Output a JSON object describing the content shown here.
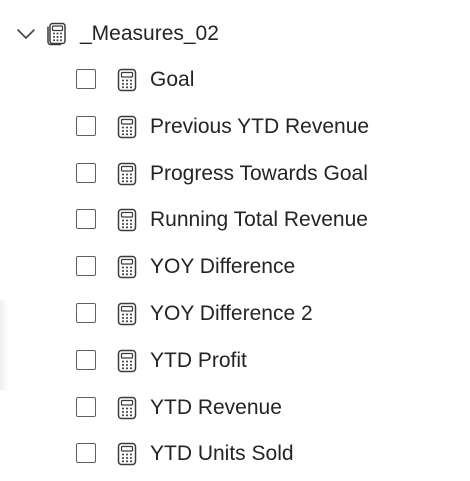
{
  "table": {
    "name": "_Measures_02",
    "expanded": true,
    "icon": "calculator-table-icon"
  },
  "fields": [
    {
      "label": "Goal",
      "checked": false,
      "icon": "calculator-icon"
    },
    {
      "label": "Previous YTD Revenue",
      "checked": false,
      "icon": "calculator-icon"
    },
    {
      "label": "Progress Towards Goal",
      "checked": false,
      "icon": "calculator-icon"
    },
    {
      "label": "Running Total Revenue",
      "checked": false,
      "icon": "calculator-icon"
    },
    {
      "label": "YOY Difference",
      "checked": false,
      "icon": "calculator-icon"
    },
    {
      "label": "YOY Difference 2",
      "checked": false,
      "icon": "calculator-icon"
    },
    {
      "label": "YTD Profit",
      "checked": false,
      "icon": "calculator-icon"
    },
    {
      "label": "YTD Revenue",
      "checked": false,
      "icon": "calculator-icon"
    },
    {
      "label": "YTD Units Sold",
      "checked": false,
      "icon": "calculator-icon"
    }
  ]
}
